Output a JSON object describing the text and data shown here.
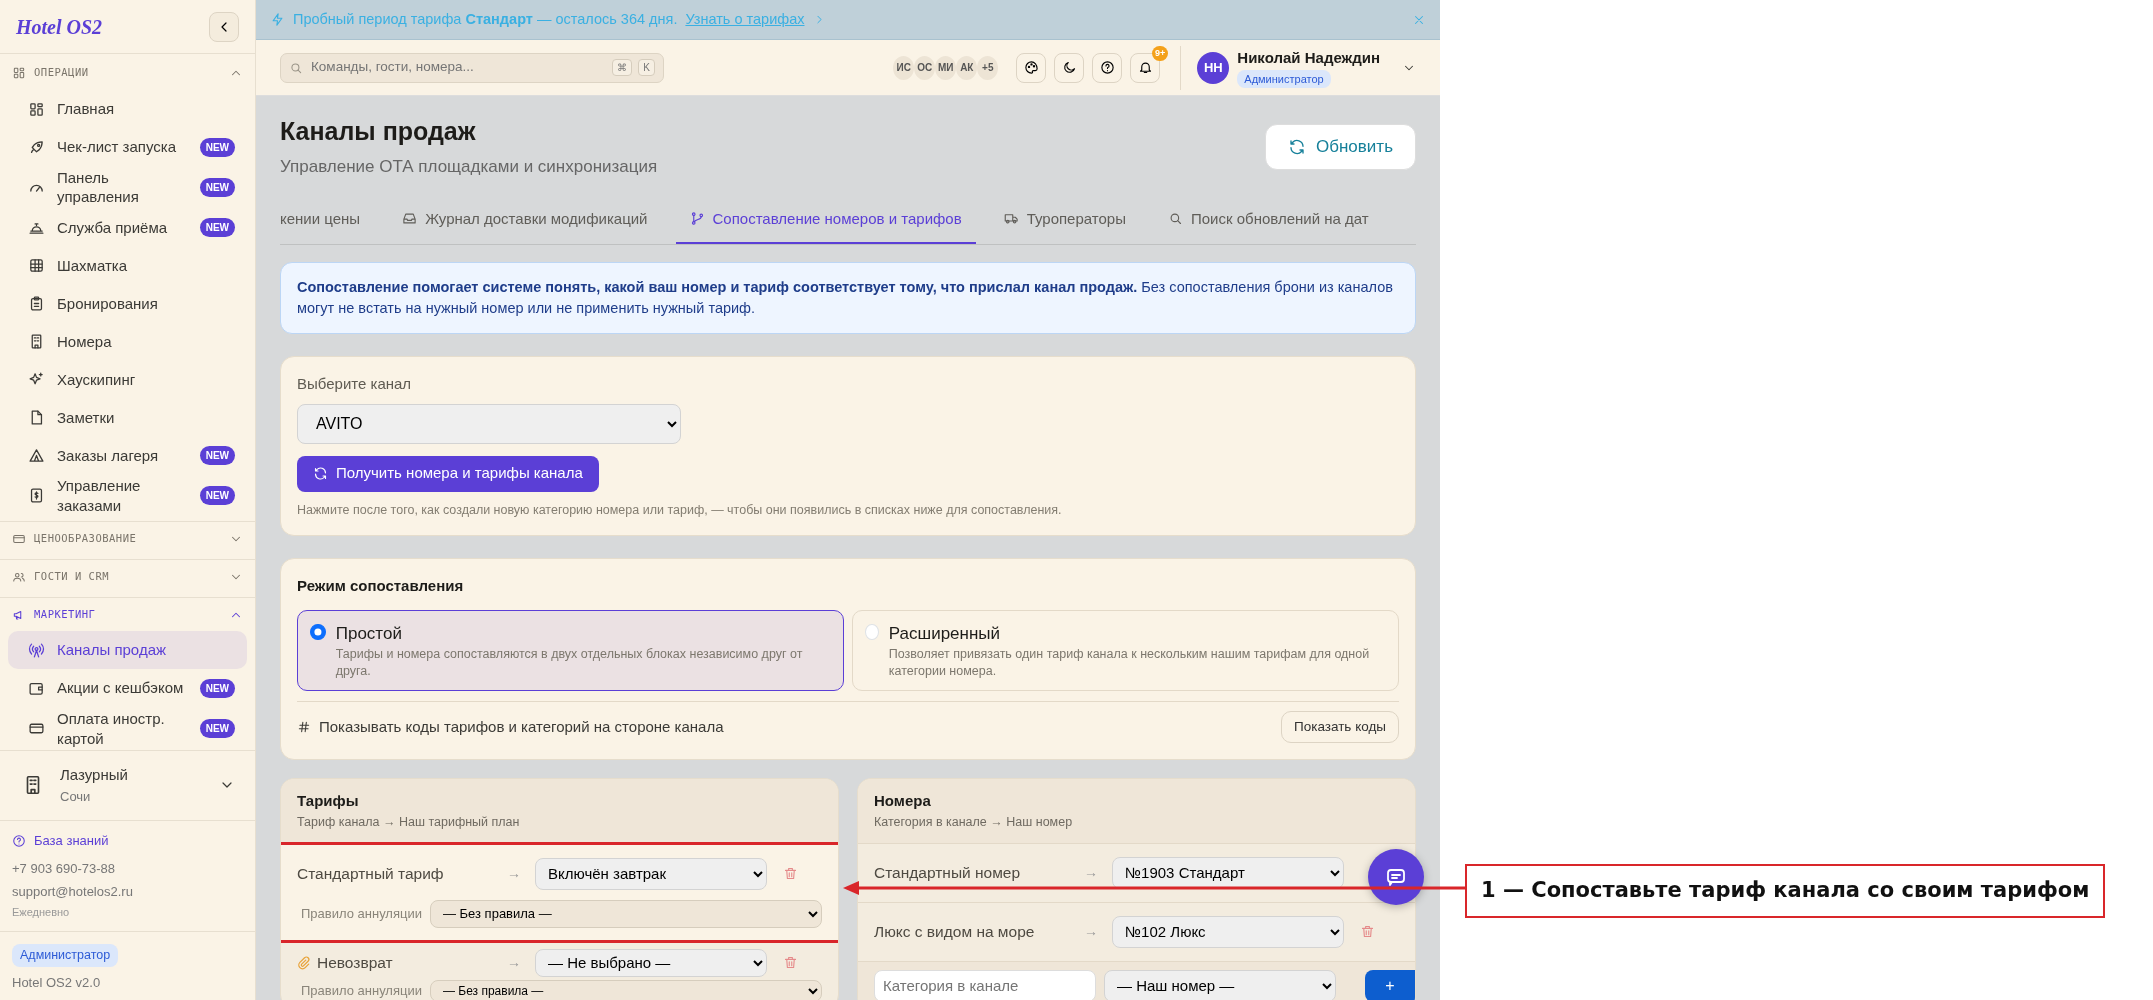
{
  "sidebar": {
    "logo": "Hotel OS2",
    "sections": [
      {
        "title": "ОПЕРАЦИИ",
        "expanded": true,
        "items": [
          {
            "label": "Главная",
            "selected": false
          },
          {
            "label": "Чек-лист запуска",
            "badge": "NEW",
            "selected": false
          },
          {
            "label": "Панель управления",
            "badge": "NEW",
            "selected": false
          },
          {
            "label": "Служба приёма",
            "badge": "NEW",
            "selected": false
          },
          {
            "label": "Шахматка",
            "selected": false
          },
          {
            "label": "Бронирования",
            "selected": false
          },
          {
            "label": "Номера",
            "selected": false
          },
          {
            "label": "Хаускипинг",
            "selected": false
          },
          {
            "label": "Заметки",
            "selected": false
          },
          {
            "label": "Заказы лагеря",
            "badge": "NEW",
            "selected": false
          },
          {
            "label": "Управление заказами",
            "badge": "NEW",
            "selected": false
          }
        ]
      },
      {
        "title": "ЦЕНООБРАЗОВАНИЕ",
        "expanded": false
      },
      {
        "title": "ГОСТИ И CRM",
        "expanded": false
      },
      {
        "title": "МАРКЕТИНГ",
        "expanded": true,
        "items": [
          {
            "label": "Каналы продаж",
            "selected": true
          },
          {
            "label": "Акции с кешбэком",
            "badge": "NEW",
            "selected": false
          },
          {
            "label": "Оплата иностр. картой",
            "badge": "NEW",
            "selected": false
          }
        ]
      }
    ],
    "hotel": {
      "name": "Лазурный",
      "city": "Сочи"
    },
    "footer": {
      "knowledge_link": "База знаний",
      "phone": "+7 903 690-73-88",
      "email": "support@hotelos2.ru",
      "hours": "Ежедневно",
      "role_badge": "Администратор",
      "version": "Hotel OS2 v2.0"
    }
  },
  "banner": {
    "text": "Пробный период тарифа **Стандарт** — осталось 364 дня.",
    "link": "Узнать о тарифах"
  },
  "topbar": {
    "search": {
      "placeholder": "Команды, гости, номера..."
    },
    "shortcut_keys": [
      "⌘",
      "K"
    ],
    "avatars": [
      "ИС",
      "ОС",
      "МИ",
      "АК"
    ],
    "more_avatars": "+5",
    "notifications_badge": "9+",
    "user": {
      "initials": "НН",
      "name": "Николай Надеждин",
      "role": "Администратор"
    }
  },
  "page": {
    "title": "Каналы продаж",
    "subtitle": "Управление ОТА площадками и синхронизация",
    "refresh_button": "Обновить"
  },
  "tabs": [
    {
      "label": "кении цены",
      "selected": false
    },
    {
      "label": "Журнал доставки модификаций",
      "selected": false
    },
    {
      "label": "Сопоставление номеров и тарифов",
      "selected": true
    },
    {
      "label": "Туроператоры",
      "selected": false
    },
    {
      "label": "Поиск обновлений на дат",
      "selected": false
    }
  ],
  "info_alert": "**Сопоставление помогает системе понять, какой ваш номер и тариф соответствует тому, что прислал канал продаж.** Без сопоставления брони из каналов могут не встать на нужный номер или не применить нужный тариф.",
  "channel_card": {
    "label": "Выберите канал",
    "channel": "AVITO",
    "fetch_button": "Получить номера и тарифы канала",
    "hint": "Нажмите после того, как создали новую категорию номера или тариф, — чтобы они появились в списках ниже для сопоставления."
  },
  "mode_card": {
    "title": "Режим сопоставления",
    "options": [
      {
        "title": "Простой",
        "description": "Тарифы и номера сопоставляются в двух отдельных блоках независимо друг от друга.",
        "selected": true
      },
      {
        "title": "Расширенный",
        "description": "Позволяет привязать один тариф канала к нескольким нашим тарифам для одной категории номера.",
        "selected": false
      }
    ],
    "codes_label": "Показывать коды тарифов и категорий на стороне канала",
    "codes_button": "Показать коды"
  },
  "tariffs": {
    "title": "Тарифы",
    "subtitle": "Тариф канала → Наш тарифный план",
    "rows": [
      {
        "name": "Стандартный тариф",
        "arrow": "→",
        "target": "Включён завтрак",
        "cancellation_label": "Правило аннуляции",
        "cancellation": "— Без правила —",
        "highlighted": true,
        "flagged": false
      },
      {
        "name": "Невозврат",
        "arrow": "→",
        "target": "— Не выбрано —",
        "cancellation_label": "Правило аннуляции",
        "cancellation": "— Без правила —",
        "highlighted": false,
        "flagged": true
      }
    ]
  },
  "rooms": {
    "title": "Номера",
    "subtitle": "Категория в канале → Наш номер",
    "rows": [
      {
        "name": "Стандартный номер",
        "arrow": "→",
        "target": "№1903 Стандарт"
      },
      {
        "name": "Люкс с видом на море",
        "arrow": "→",
        "target": "№102 Люкс"
      }
    ],
    "new_row": {
      "placeholder": "Категория в канале",
      "target": "— Наш номер —",
      "add_button": "+"
    }
  },
  "callout": {
    "text": "1 — Сопоставьте тариф канала со своим тарифом"
  }
}
